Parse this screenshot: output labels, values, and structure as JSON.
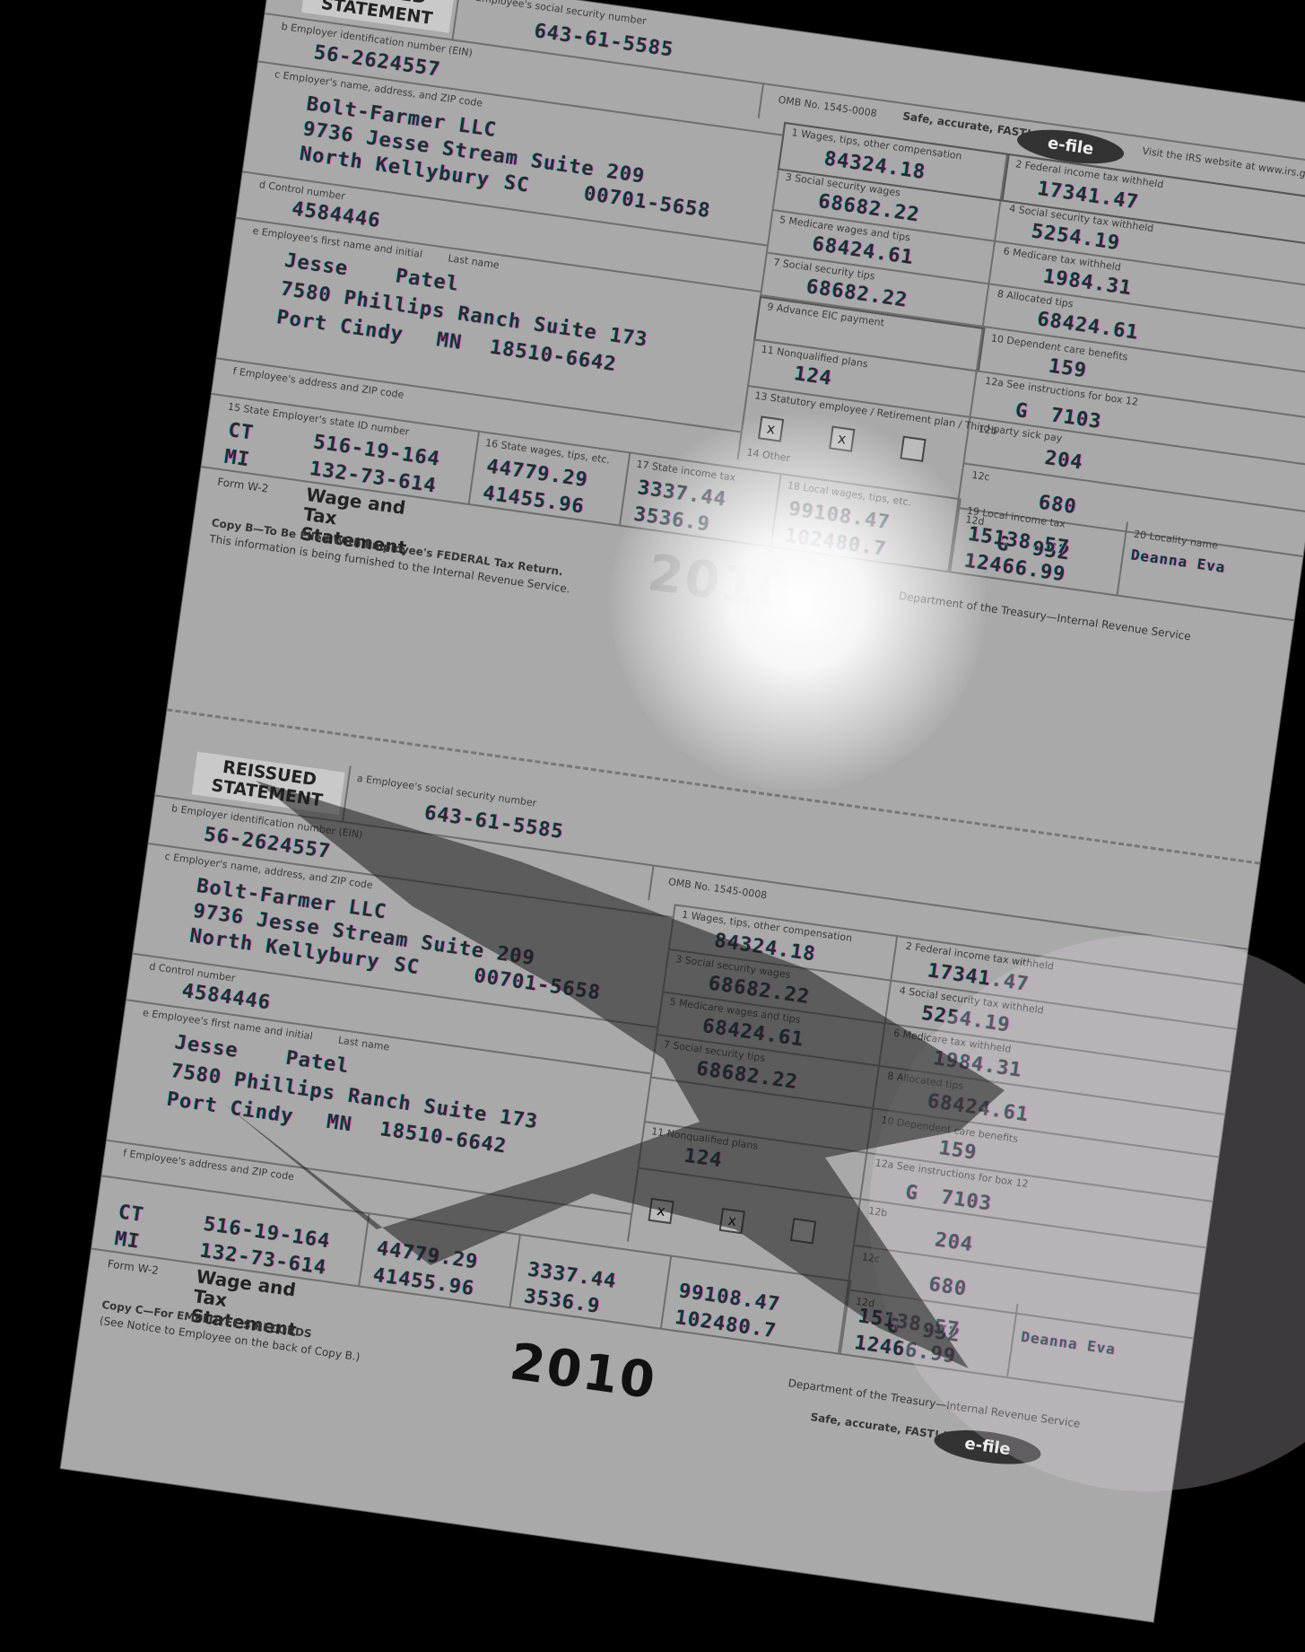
{
  "form": {
    "reissued": "REISSUED STATEMENT",
    "box_a_label": "a Employee's social security number",
    "ssn": "643-61-5585",
    "box_b_label": "b Employer identification number (EIN)",
    "ein": "56-2624557",
    "box_c_label": "c Employer's name, address, and ZIP code",
    "employer_name": "Bolt-Farmer LLC",
    "employer_street": "9736 Jesse Stream Suite 209",
    "employer_city": "North Kellybury",
    "employer_state": "SC",
    "employer_zip": "00701-5658",
    "box_d_label": "d Control number",
    "control": "4584446",
    "box_e_label": "e Employee's first name and initial",
    "last_name_label": "Last name",
    "employee_first": "Jesse",
    "employee_last": "Patel",
    "employee_street": "7580 Phillips Ranch Suite 173",
    "employee_city": "Port Cindy",
    "employee_state": "MN",
    "employee_zip": "18510-6642",
    "box_f_label": "f Employee's address and ZIP code",
    "omb_label": "OMB No. 1545-0008",
    "safe": "Safe, accurate, FAST! Use",
    "efile": "e-file",
    "visit": "Visit the IRS website at www.irs.gov/efile",
    "box1": "84324.18",
    "box2": "17341.47",
    "box3": "68682.22",
    "box4": "5254.19",
    "box5": "68424.61",
    "box6": "1984.31",
    "box7": "68682.22",
    "box8": "68424.61",
    "box9": "",
    "box10": "159",
    "box11": "124",
    "box12a_code": "G",
    "box12a": "7103",
    "box12b": "204",
    "box12c": "680",
    "box12d_code": "G",
    "box12d": "952",
    "box13_statutory": "x",
    "box13_retirement": "x",
    "state1": "CT",
    "state1_id": "516-19-164",
    "state2": "MI",
    "state2_id": "132-73-614",
    "state_wages1": "44779.29",
    "state_wages2": "41455.96",
    "state_tax1": "3337.44",
    "state_tax2": "3536.9",
    "local_wages1": "99108.47",
    "local_wages2": "102480.7",
    "local_tax1": "15138.57",
    "local_tax2": "12466.99",
    "locality1": "Deanna Eva",
    "title_form": "Form W-2",
    "title_wage": "Wage and Tax Statement",
    "year": "2010",
    "copyB_text1": "Copy B—To Be Filed With Employee's FEDERAL Tax Return.",
    "copyB_text2": "This information is being furnished to the Internal Revenue Service.",
    "copyC_text1": "Copy C—For EMPLOYEE'S RECORDS",
    "copyC_text2": "(See Notice to Employee on the back of Copy B.)",
    "dept": "Department of the Treasury—Internal Revenue Service"
  }
}
